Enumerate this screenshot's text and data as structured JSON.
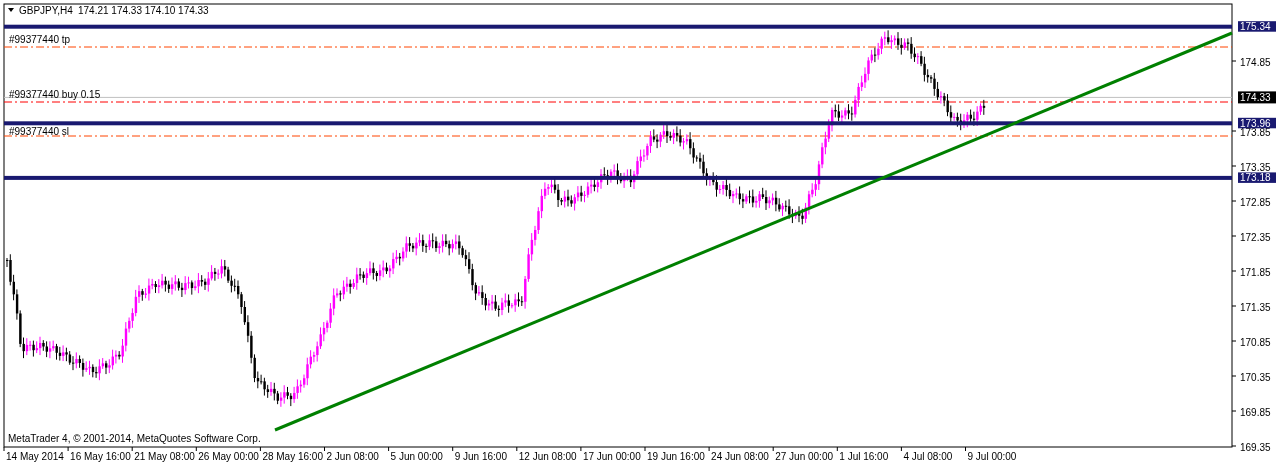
{
  "chart": {
    "symbol": "GBPJPY,H4",
    "ohlc": "174.21 174.33 174.10 174.33",
    "orders": [
      {
        "kind": "tp",
        "label": "#99377440 tp"
      },
      {
        "kind": "entry",
        "label": "#99377440 buy 0.15"
      },
      {
        "kind": "sl",
        "label": "#99377440 sl"
      }
    ],
    "horizontal_lines": [
      {
        "price_label": "175.34"
      },
      {
        "price_label": "173.96"
      },
      {
        "price_label": "173.18"
      }
    ],
    "bid_label": "174.33",
    "price_ticks": [
      "174.85",
      "173.85",
      "173.35",
      "172.85",
      "172.35",
      "171.85",
      "171.35",
      "170.85",
      "170.35",
      "169.85",
      "169.35"
    ],
    "time_labels": [
      "14 May 2014",
      "16 May 16:00",
      "21 May 08:00",
      "26 May 00:00",
      "28 May 16:00",
      "2 Jun 08:00",
      "5 Jun 00:00",
      "9 Jun 16:00",
      "12 Jun 08:00",
      "17 Jun 00:00",
      "19 Jun 16:00",
      "24 Jun 08:00",
      "27 Jun 00:00",
      "1 Jul 16:00",
      "4 Jul 08:00",
      "9 Jul 00:00"
    ],
    "copyright": "MetaTrader 4, © 2001-2014, MetaQuotes Software Corp."
  }
}
